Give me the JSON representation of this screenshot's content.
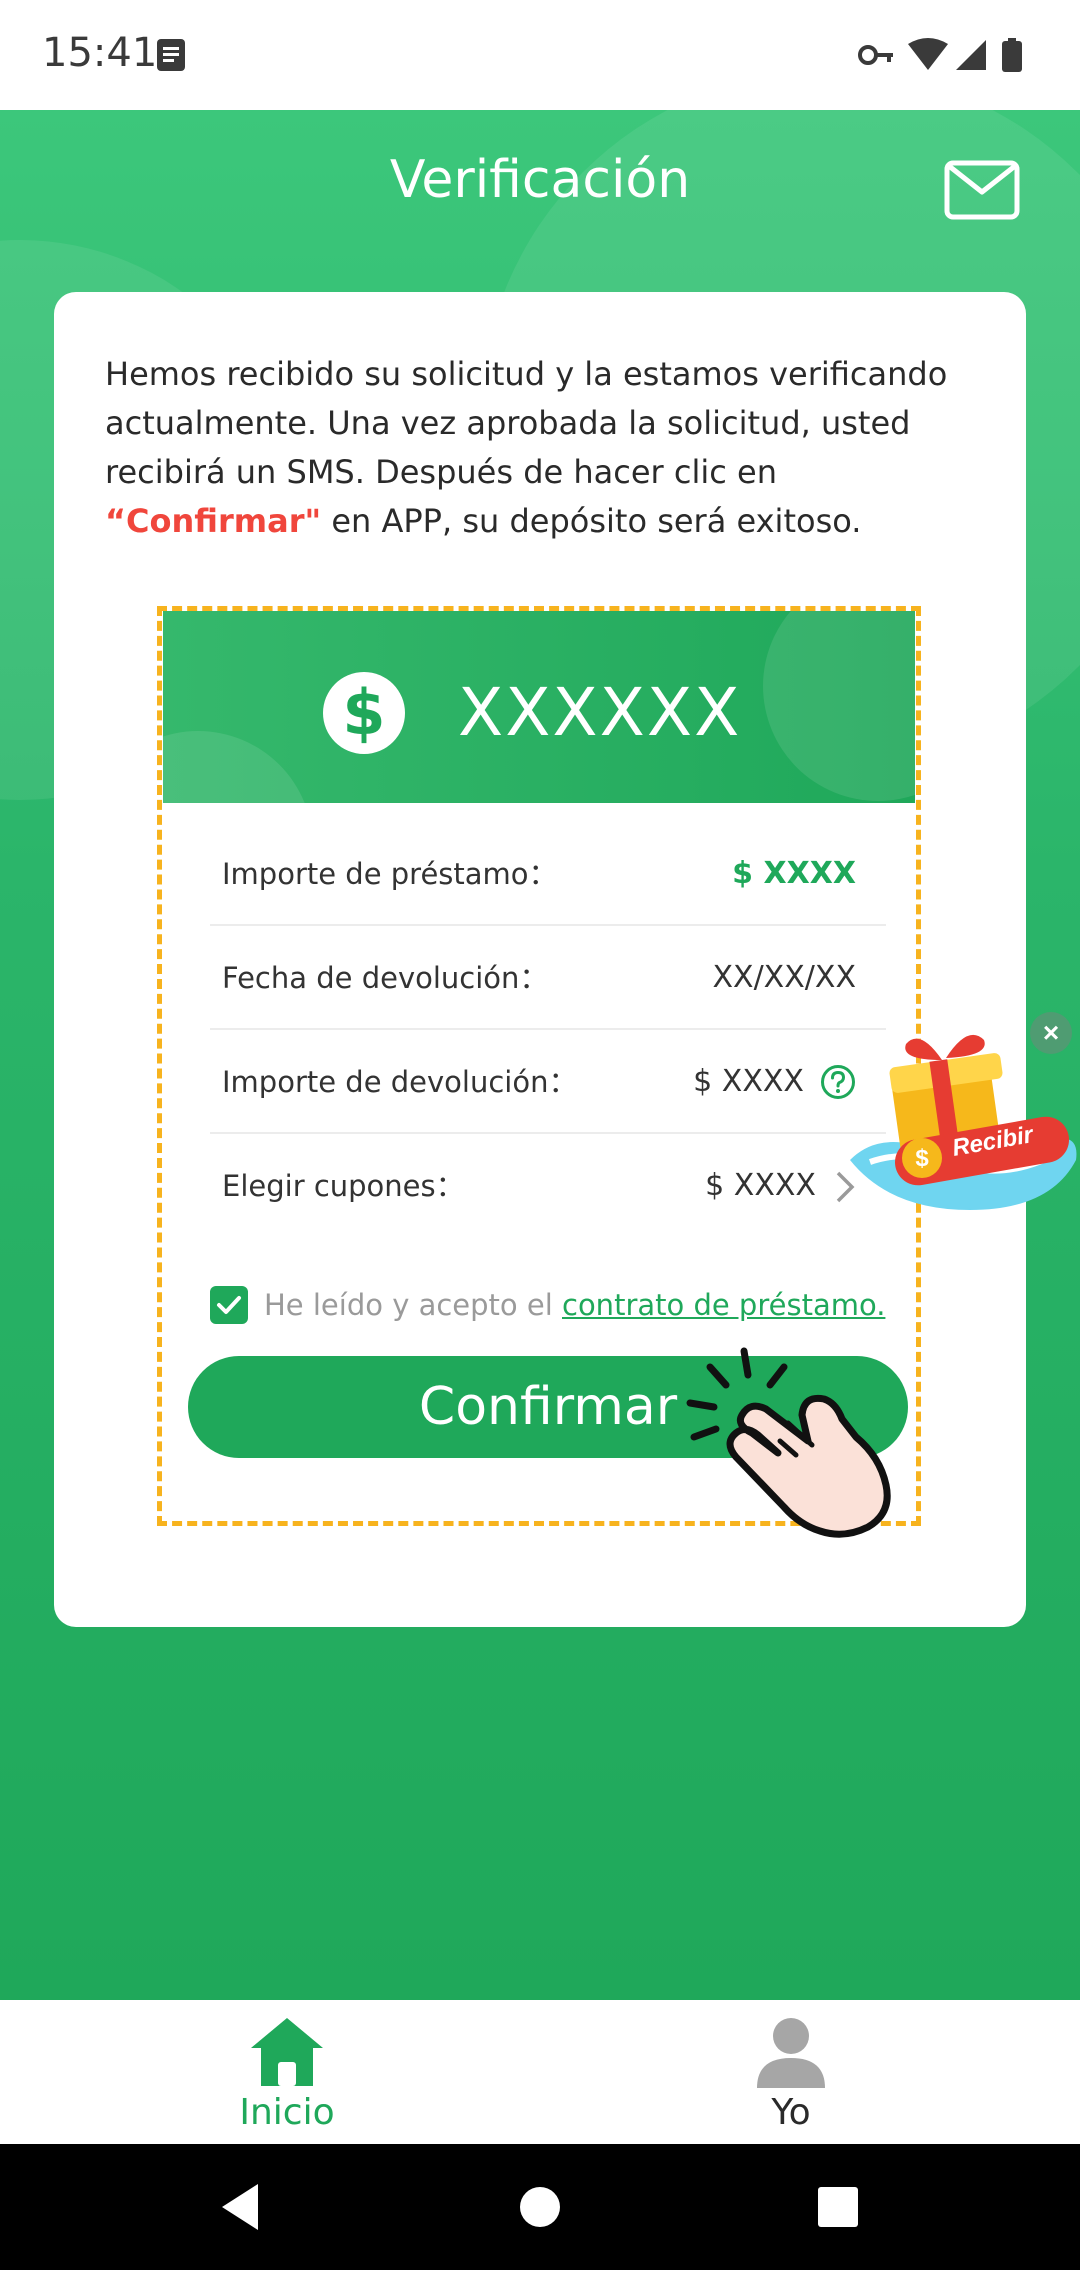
{
  "status_bar": {
    "time": "15:41"
  },
  "header": {
    "title": "Verificación"
  },
  "intro": {
    "text_before": "Hemos recibido su solicitud y la estamos verificando actualmente. Una vez aprobada la solicitud, usted recibirá un SMS. Después de hacer clic en ",
    "highlight": "“Confirmar\"",
    "text_after": " en APP, su depósito será exitoso."
  },
  "loan": {
    "amount": "XXXXXX",
    "rows": [
      {
        "label": "Importe de préstamo：",
        "value": "$ XXXX"
      },
      {
        "label": "Fecha de devolución：",
        "value": "XX/XX/XX"
      },
      {
        "label": "Importe de devolución：",
        "value": "$ XXXX"
      },
      {
        "label": "Elegir cupones：",
        "value": "$ XXXX"
      }
    ],
    "agree_text": "He leído y acepto el ",
    "agree_link": "contrato de préstamo.",
    "confirm_label": "Confirmar"
  },
  "gift": {
    "label": "Recibir",
    "close": "×"
  },
  "tabs": [
    {
      "label": "Inicio",
      "active": true
    },
    {
      "label": "Yo",
      "active": false
    }
  ],
  "colors": {
    "primary": "#1fa85a",
    "accent": "#f0463c",
    "dashed": "#f7b31e"
  }
}
